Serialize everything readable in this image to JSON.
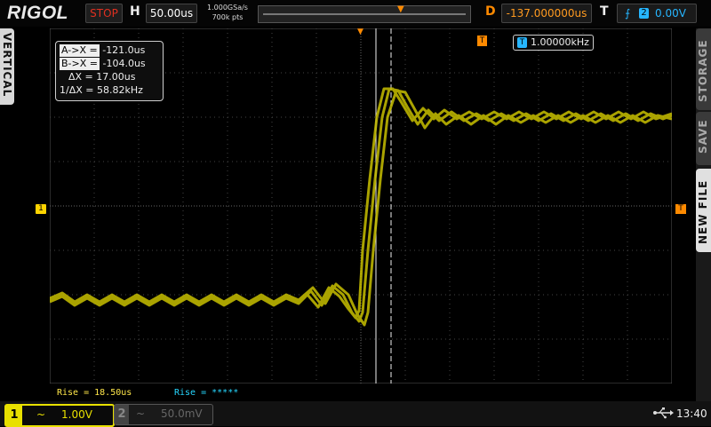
{
  "brand": "RIGOL",
  "run_state": "STOP",
  "horizontal": {
    "label": "H",
    "scale": "50.00us"
  },
  "sample": {
    "rate": "1.000GSa/s",
    "points": "700k pts"
  },
  "delay": {
    "label": "D",
    "value": "-137.000000us"
  },
  "trigger": {
    "label": "T",
    "source": "2",
    "level": "0.00V"
  },
  "left_tab": "VERTICAL",
  "right_tabs": [
    "STORAGE",
    "SAVE",
    "NEW FILE"
  ],
  "cursor_readout": {
    "a_label": "A->X =",
    "a_value": "-121.0us",
    "b_label": "B->X =",
    "b_value": "-104.0us",
    "dx_label": "ΔX =",
    "dx_value": "17.00us",
    "inv_label": "1/ΔX =",
    "inv_value": "58.82kHz"
  },
  "frequency_counter": {
    "icon": "T",
    "value": "1.00000kHz"
  },
  "channel_marker": "1",
  "trigger_marker": "T",
  "measurements": [
    "Rise = 18.50us",
    "Rise = *****"
  ],
  "channels": [
    {
      "num": "1",
      "coupling": "~",
      "scale": "1.00V"
    },
    {
      "num": "2",
      "coupling": "~",
      "scale": "50.0mV"
    }
  ],
  "time": "13:40",
  "colors": {
    "ch1": "#e8e000",
    "ch2_meas": "#26d7ff",
    "trigger": "#ff8a00",
    "accent": "#26b6ff"
  }
}
